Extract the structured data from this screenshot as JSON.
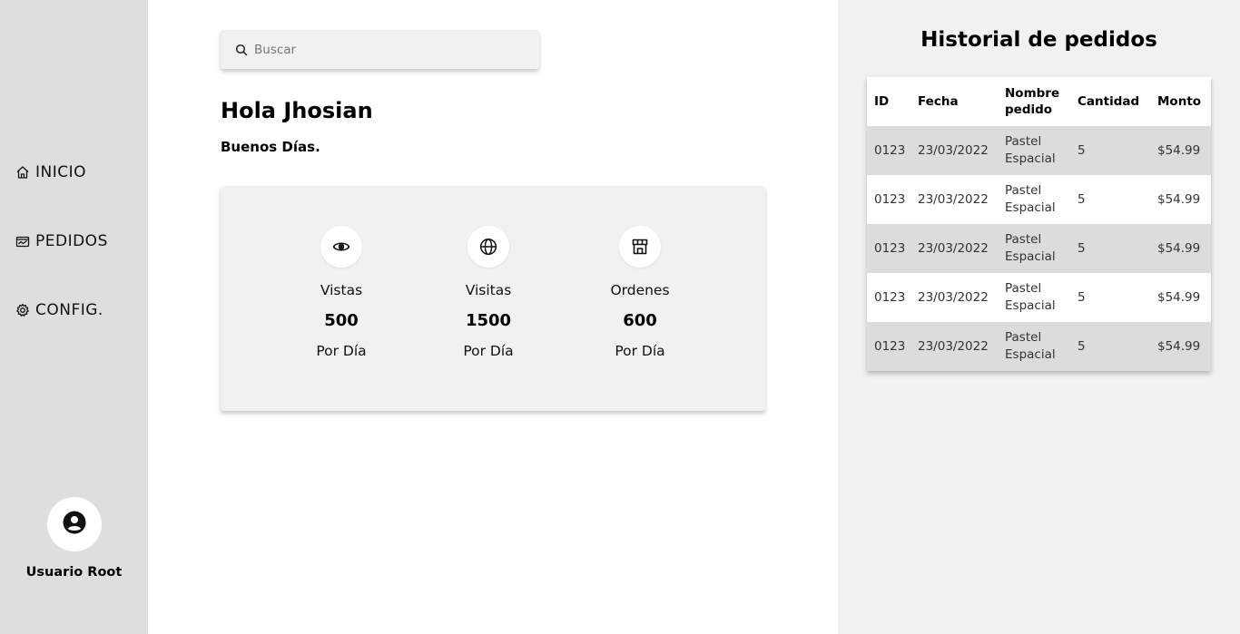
{
  "sidebar": {
    "items": [
      {
        "label": "INICIO",
        "icon": "home-icon"
      },
      {
        "label": "PEDIDOS",
        "icon": "orders-icon"
      },
      {
        "label": "CONFIG.",
        "icon": "gear-icon"
      }
    ],
    "user": {
      "name": "Usuario Root",
      "icon": "user-circle-icon"
    }
  },
  "search": {
    "placeholder": "Buscar",
    "icon": "search-icon"
  },
  "greeting": {
    "title": "Hola Jhosian",
    "subtitle": "Buenos Días."
  },
  "stats": [
    {
      "icon": "eye-icon",
      "title": "Vistas",
      "value": "500",
      "per": "Por Día"
    },
    {
      "icon": "globe-icon",
      "title": "Visitas",
      "value": "1500",
      "per": "Por Día"
    },
    {
      "icon": "store-icon",
      "title": "Ordenes",
      "value": "600",
      "per": "Por Día"
    }
  ],
  "history": {
    "title": "Historial de pedidos",
    "columns": [
      "ID",
      "Fecha",
      "Nombre pedido",
      "Cantidad",
      "Monto"
    ],
    "rows": [
      [
        "0123",
        "23/03/2022",
        "Pastel Espacial",
        "5",
        "$54.99"
      ],
      [
        "0123",
        "23/03/2022",
        "Pastel Espacial",
        "5",
        "$54.99"
      ],
      [
        "0123",
        "23/03/2022",
        "Pastel Espacial",
        "5",
        "$54.99"
      ],
      [
        "0123",
        "23/03/2022",
        "Pastel Espacial",
        "5",
        "$54.99"
      ],
      [
        "0123",
        "23/03/2022",
        "Pastel Espacial",
        "5",
        "$54.99"
      ]
    ]
  }
}
